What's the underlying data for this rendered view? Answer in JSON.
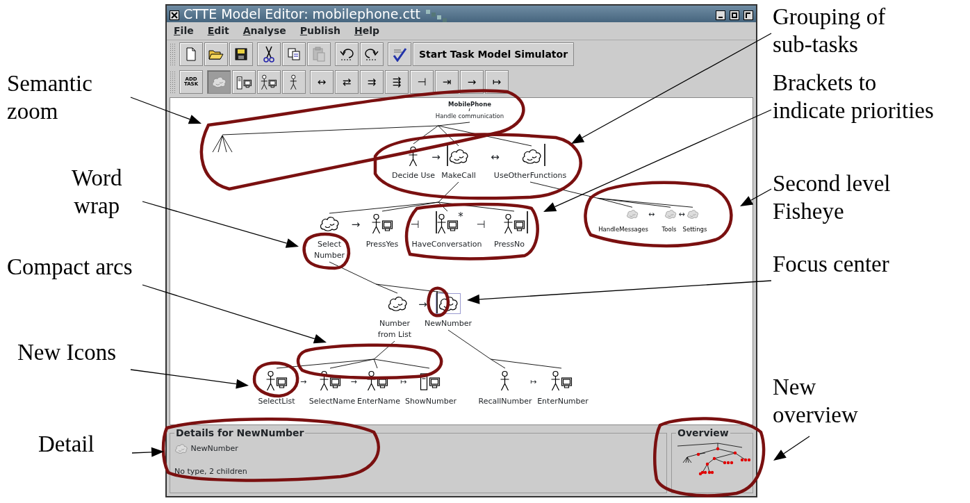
{
  "window": {
    "title": "CTTE Model Editor: mobilephone.ctt"
  },
  "menu": [
    {
      "label": "File"
    },
    {
      "label": "Edit"
    },
    {
      "label": "Analyse"
    },
    {
      "label": "Publish"
    },
    {
      "label": "Help"
    }
  ],
  "toolbar": [
    [
      {
        "kind": "new",
        "disabled": false
      },
      {
        "kind": "open",
        "disabled": false
      },
      {
        "kind": "save",
        "disabled": false
      }
    ],
    [
      {
        "kind": "cut",
        "disabled": false
      },
      {
        "kind": "copy",
        "disabled": false
      },
      {
        "kind": "paste",
        "disabled": true
      }
    ],
    [
      {
        "kind": "undo",
        "disabled": false
      },
      {
        "kind": "redo",
        "disabled": false
      }
    ],
    [
      {
        "kind": "spellcheck",
        "disabled": false
      },
      {
        "kind": "text",
        "label": "Start Task Model Simulator",
        "disabled": false
      }
    ]
  ],
  "task_toolbar": [
    [
      {
        "kind": "text",
        "label": "ADD\nTASK"
      }
    ],
    [
      {
        "kind": "abstract",
        "selected": true
      },
      {
        "kind": "application",
        "selected": false
      },
      {
        "kind": "interaction",
        "selected": false
      },
      {
        "kind": "user",
        "selected": false
      }
    ],
    [
      {
        "kind": "operator",
        "label": "↔"
      },
      {
        "kind": "operator",
        "label": "⇄"
      },
      {
        "kind": "operator",
        "label": "⇉"
      },
      {
        "kind": "operator",
        "label": "⇶"
      },
      {
        "kind": "operator",
        "label": "⊣"
      },
      {
        "kind": "operator",
        "label": "⇥"
      },
      {
        "kind": "operator",
        "label": "→"
      },
      {
        "kind": "operator",
        "label": "↦"
      }
    ]
  ],
  "tree": {
    "kind": "root",
    "label": "MobilePhone",
    "subtitle": "Handle communication",
    "children": [
      {
        "kind": "collapsed"
      },
      {
        "kind": "user",
        "label": "Decide Use",
        "operator": "→",
        "focused": false,
        "faded": false
      },
      {
        "kind": "abstract",
        "label": "MakeCall",
        "operator": "↔",
        "bracket_open": true,
        "focused": false,
        "faded": false,
        "children": [
          {
            "kind": "abstract",
            "label": "Select\nNumber",
            "operator": "→",
            "focused": false,
            "faded": false,
            "children": [
              {
                "kind": "abstract",
                "label": "Number\nfrom List",
                "operator": "→",
                "focused": false,
                "faded": false,
                "children": [
                  {
                    "kind": "interaction",
                    "label": "SelectList",
                    "operator": "→",
                    "focused": false,
                    "faded": false
                  },
                  {
                    "kind": "interaction",
                    "label": "SelectName",
                    "operator": "→",
                    "focused": false,
                    "faded": false
                  },
                  {
                    "kind": "interaction",
                    "label": "EnterName",
                    "operator": "↦",
                    "focused": false,
                    "faded": false
                  },
                  {
                    "kind": "application",
                    "label": "ShowNumber",
                    "focused": false,
                    "faded": false
                  }
                ]
              },
              {
                "kind": "abstract",
                "label": "NewNumber",
                "bracket_open": true,
                "focused": true,
                "faded": false,
                "children": [
                  {
                    "kind": "user",
                    "label": "RecallNumber",
                    "operator": "↦",
                    "focused": false,
                    "faded": false
                  },
                  {
                    "kind": "interaction",
                    "label": "EnterNumber",
                    "focused": false,
                    "faded": false
                  }
                ]
              }
            ]
          },
          {
            "kind": "interaction",
            "label": "PressYes",
            "operator": "⊣",
            "focused": false,
            "faded": false
          },
          {
            "kind": "interaction",
            "label": "HaveConversation",
            "marker": "*",
            "operator": "⊣",
            "bracket_open": true,
            "focused": false,
            "faded": false
          },
          {
            "kind": "interaction",
            "label": "PressNo",
            "bracket_close": true,
            "focused": false,
            "faded": false
          }
        ]
      },
      {
        "kind": "abstract",
        "label": "UseOtherFunctions",
        "bracket_close": true,
        "focused": false,
        "faded": false,
        "children": [
          {
            "kind": "abstract",
            "label": "HandleMessages",
            "operator": "↔",
            "focused": false,
            "faded": true
          },
          {
            "kind": "abstract",
            "label": "Tools",
            "operator": "↔",
            "focused": false,
            "faded": true
          },
          {
            "kind": "abstract",
            "label": "Settings",
            "focused": false,
            "faded": true
          }
        ]
      }
    ]
  },
  "details": {
    "title": "Details for NewNumber",
    "kind": "abstract",
    "task_name": "NewNumber",
    "info": "No type, 2 children"
  },
  "overview": {
    "title": "Overview"
  },
  "annotations": [
    {
      "text": "Semantic\nzoom"
    },
    {
      "text": "Word\nwrap"
    },
    {
      "text": "Compact arcs"
    },
    {
      "text": "New Icons"
    },
    {
      "text": "Detail"
    },
    {
      "text": "Grouping of\nsub-tasks"
    },
    {
      "text": "Brackets to\nindicate priorities"
    },
    {
      "text": "Second level\nFisheye"
    },
    {
      "text": "Focus center"
    },
    {
      "text": "New\noverview"
    }
  ]
}
